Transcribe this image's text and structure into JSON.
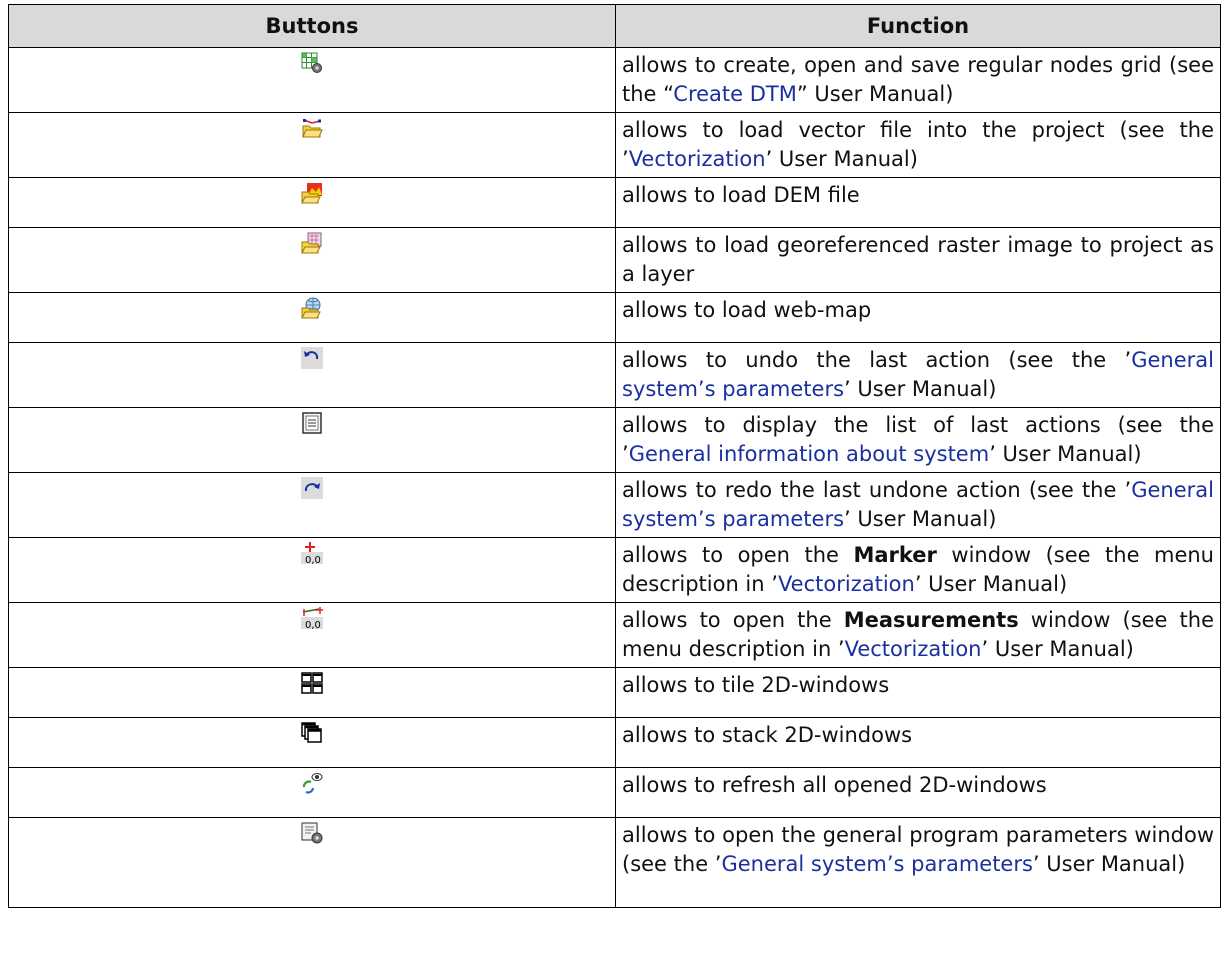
{
  "headers": {
    "buttons": "Buttons",
    "function": "Function"
  },
  "rows": [
    {
      "icon": "grid-gear-icon",
      "parts": [
        {
          "t": "allows to create, open and save regular nodes grid (see the “"
        },
        {
          "t": "Create DTM",
          "style": "link"
        },
        {
          "t": "” User Manual)"
        }
      ]
    },
    {
      "icon": "open-vector-folder-icon",
      "parts": [
        {
          "t": "allows to load vector file into the project (see the ’"
        },
        {
          "t": "Vectorization",
          "style": "link"
        },
        {
          "t": "’ User Manual)"
        }
      ]
    },
    {
      "icon": "open-dem-folder-icon",
      "parts": [
        {
          "t": "allows to load DEM file"
        }
      ]
    },
    {
      "icon": "open-raster-folder-icon",
      "parts": [
        {
          "t": "allows to load georeferenced raster image to project as a layer"
        }
      ]
    },
    {
      "icon": "open-web-map-folder-icon",
      "parts": [
        {
          "t": "allows to load web-map"
        }
      ]
    },
    {
      "icon": "undo-icon",
      "parts": [
        {
          "t": "allows to undo the last action (see the ’"
        },
        {
          "t": "General system’s parameters",
          "style": "link"
        },
        {
          "t": "’ User Manual)"
        }
      ]
    },
    {
      "icon": "action-list-icon",
      "parts": [
        {
          "t": "allows to display the list of last actions (see the ’"
        },
        {
          "t": "General information about system",
          "style": "link"
        },
        {
          "t": "’ User Manual)"
        }
      ]
    },
    {
      "icon": "redo-icon",
      "parts": [
        {
          "t": "allows to redo the last undone action (see the ’"
        },
        {
          "t": "General system’s parameters",
          "style": "link"
        },
        {
          "t": "’ User Manual)"
        }
      ]
    },
    {
      "icon": "marker-icon",
      "parts": [
        {
          "t": "allows to open the "
        },
        {
          "t": "Marker",
          "style": "bold"
        },
        {
          "t": " window (see the menu description in ’"
        },
        {
          "t": "Vectorization",
          "style": "link"
        },
        {
          "t": "’ User Manual)"
        }
      ]
    },
    {
      "icon": "measurements-icon",
      "parts": [
        {
          "t": "allows to open the "
        },
        {
          "t": "Measurements",
          "style": "bold"
        },
        {
          "t": " window (see the menu description in ’"
        },
        {
          "t": "Vectorization",
          "style": "link"
        },
        {
          "t": "’ User Manual)"
        }
      ]
    },
    {
      "icon": "tile-windows-icon",
      "parts": [
        {
          "t": "allows to tile 2D-windows"
        }
      ]
    },
    {
      "icon": "stack-windows-icon",
      "parts": [
        {
          "t": "allows to stack 2D-windows"
        }
      ]
    },
    {
      "icon": "refresh-windows-icon",
      "parts": [
        {
          "t": "allows to refresh all opened 2D-windows"
        }
      ]
    },
    {
      "icon": "parameters-gear-icon",
      "parts": [
        {
          "t": "allows to open the general program parameters window (see the ’"
        },
        {
          "t": "General system’s parameters",
          "style": "link"
        },
        {
          "t": "’ User Manual)"
        }
      ]
    }
  ]
}
